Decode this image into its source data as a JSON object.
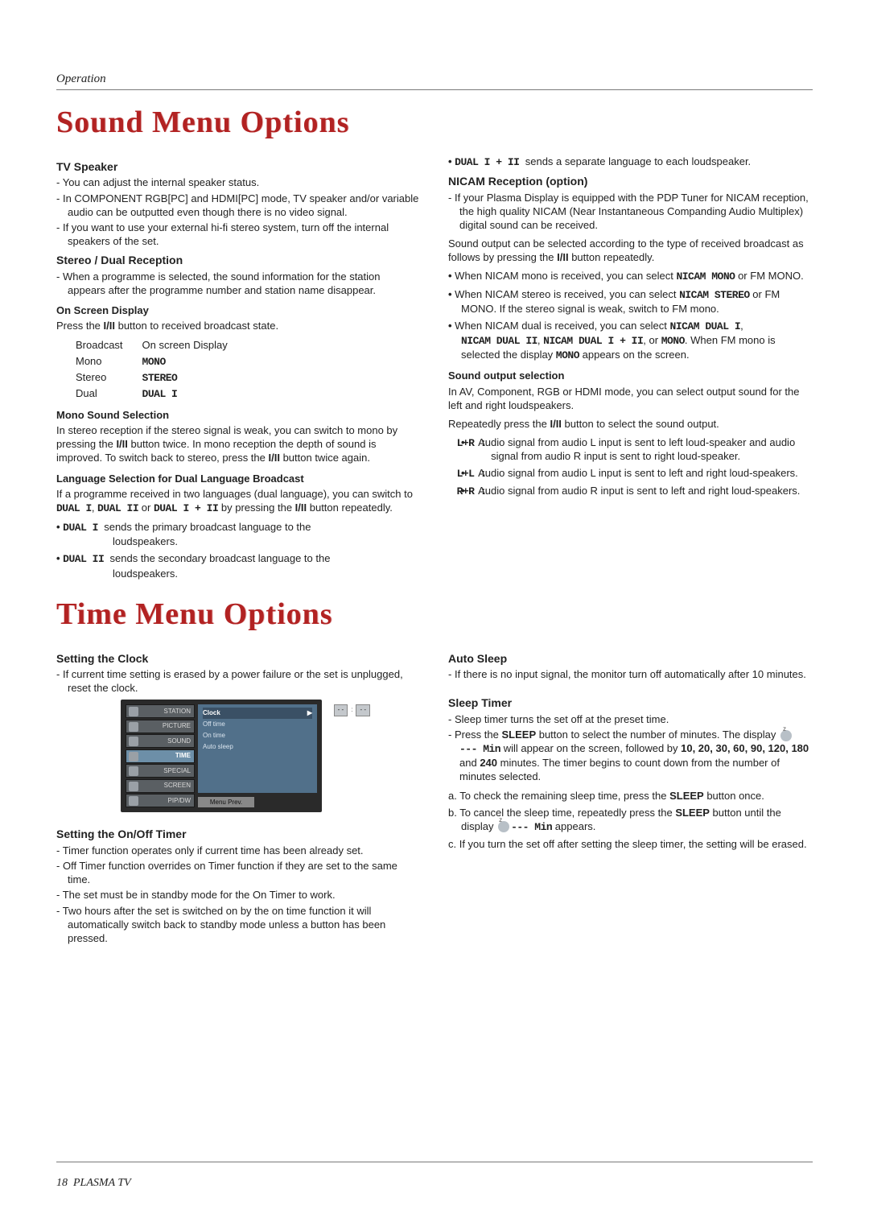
{
  "header": {
    "section_label": "Operation"
  },
  "sound": {
    "title": "Sound Menu Options",
    "tv_speaker": {
      "heading": "TV Speaker",
      "items": [
        "You can adjust the internal speaker status.",
        "In COMPONENT RGB[PC] and HDMI[PC] mode, TV speaker and/or variable audio can be outputted even though there is no video signal.",
        "If you want to use your external hi-fi stereo system, turn off the internal speakers of the set."
      ]
    },
    "stereo_dual": {
      "heading": "Stereo / Dual Reception",
      "items": [
        "When a programme is selected, the sound information for the station appears after the programme number and station name disappear."
      ]
    },
    "osd": {
      "label": "On Screen Display",
      "instruction_pre": "Press the ",
      "btn": "I/II",
      "instruction_post": " button to received broadcast state.",
      "th1": "Broadcast",
      "th2": "On screen Display",
      "rows": [
        {
          "c1": "Mono",
          "c2": "MONO"
        },
        {
          "c1": "Stereo",
          "c2": "STEREO"
        },
        {
          "c1": "Dual",
          "c2": "DUAL I"
        }
      ]
    },
    "mono_sel": {
      "label": "Mono Sound Selection",
      "text_a": "In stereo reception if the stereo signal is weak, you can switch to mono by pressing the ",
      "btn": "I/II",
      "text_b": " button twice. In mono reception the depth of sound is improved. To switch back to stereo, press the ",
      "text_c": " button twice again."
    },
    "lang_sel": {
      "label": "Language Selection for Dual Language Broadcast",
      "text_a": "If a programme received in two languages (dual language), you can switch to ",
      "opt1": "DUAL I",
      "opt2": "DUAL II",
      "opt3": "DUAL I + II",
      "text_b": " by pressing the ",
      "btn": "I/II",
      "text_c": " button repeatedly.",
      "bul1_a": "DUAL I",
      "bul1_b": "sends the primary broadcast language to the",
      "bul1_c": "loudspeakers.",
      "bul2_a": "DUAL II",
      "bul2_b": "sends the secondary broadcast language to the",
      "bul2_c": "loudspeakers.",
      "bul3_a": "DUAL I + II",
      "bul3_b": "sends a separate language to each loudspeaker."
    },
    "nicam": {
      "heading": "NICAM Reception (option)",
      "items": [
        "If your Plasma Display is equipped with the PDP Tuner for NICAM reception, the high quality NICAM (Near Instantaneous Companding Audio Multiplex) digital sound can be received."
      ],
      "para_a": "Sound output can be selected according to the type of received broadcast as follows by pressing the ",
      "btn": "I/II",
      "para_b": " button repeatedly.",
      "b1_a": "When NICAM mono is received, you can select ",
      "b1_b": "NICAM MONO",
      "b1_c": " or FM MONO.",
      "b2_a": "When NICAM stereo is received, you can select ",
      "b2_b": "NICAM STEREO",
      "b2_c": " or FM MONO. If the stereo signal is weak, switch to FM mono.",
      "b3_a": "When NICAM dual is received, you can select ",
      "b3_b": "NICAM DUAL I",
      "b3_c": "NICAM DUAL II",
      "b3_d": "NICAM DUAL I + II",
      "b3_e": "MONO",
      "b3_f": ". When FM mono is selected the display ",
      "b3_g": "MONO",
      "b3_h": " appears on the screen."
    },
    "sound_out": {
      "label": "Sound output selection",
      "p1": "In AV, Component, RGB or HDMI mode, you can select output sound for the left and right loudspeakers.",
      "p2_a": "Repeatedly press the ",
      "btn": "I/II",
      "p2_b": " button to select the sound output.",
      "r1_k": "L+R :",
      "r1_v": "Audio signal from audio L input is sent to left loud-speaker and audio signal from audio R input is sent to right loud-speaker.",
      "r2_k": "L+L :",
      "r2_v": "Audio signal from audio L input is sent to left and right loud-speakers.",
      "r3_k": "R+R :",
      "r3_v": "Audio signal from audio R input is sent to left and right loud-speakers."
    }
  },
  "time": {
    "title": "Time Menu Options",
    "clock": {
      "heading": "Setting the Clock",
      "items": [
        "If current time setting is erased by a power failure or the set is unplugged, reset the clock."
      ]
    },
    "onoff": {
      "heading": "Setting the On/Off Timer",
      "items": [
        "Timer function operates only if current time has been already set.",
        "Off Timer function overrides on Timer function if they are set to the same time.",
        "The set must be in standby mode for the On Timer to work.",
        "Two hours after the set is switched on by the on time function it will automatically switch back to standby mode unless a button has been pressed."
      ]
    },
    "auto": {
      "heading": "Auto Sleep",
      "items": [
        "If there is no input signal, the monitor turn off automatically after 10 minutes."
      ]
    },
    "sleep": {
      "heading": "Sleep Timer",
      "d1": "Sleep timer turns the set off at the preset time.",
      "d2_a": "Press the ",
      "d2_b": "SLEEP",
      "d2_c": " button to select the number of minutes. The display ",
      "d2_min": "--- Min",
      "d2_d": " will appear on the screen, followed by ",
      "mins": "10, 20, 30, 60, 90, 120, 180",
      "and": " and ",
      "last": "240",
      "d2_e": " minutes. The timer begins to count down from the number of minutes selected.",
      "a_a": "a. To check the remaining sleep time, press the ",
      "a_b": "SLEEP",
      "a_c": " button once.",
      "b_a": "b. To cancel the sleep time, repeatedly press the ",
      "b_b": "SLEEP",
      "b_c": " button until the display ",
      "b_min": "--- Min",
      "b_d": " appears.",
      "c": "c. If you turn the set off after setting the sleep timer, the setting will be erased."
    },
    "menu": {
      "tabs": [
        "STATION",
        "PICTURE",
        "SOUND",
        "TIME",
        "SPECIAL",
        "SCREEN",
        "PIP/DW"
      ],
      "items": [
        "Clock",
        "Off time",
        "On time",
        "Auto sleep"
      ],
      "menu_prev": "Menu  Prev.",
      "clock_val_h": "- -",
      "clock_val_m": "- -"
    }
  },
  "footer": {
    "page": "18",
    "label": "PLASMA TV"
  }
}
